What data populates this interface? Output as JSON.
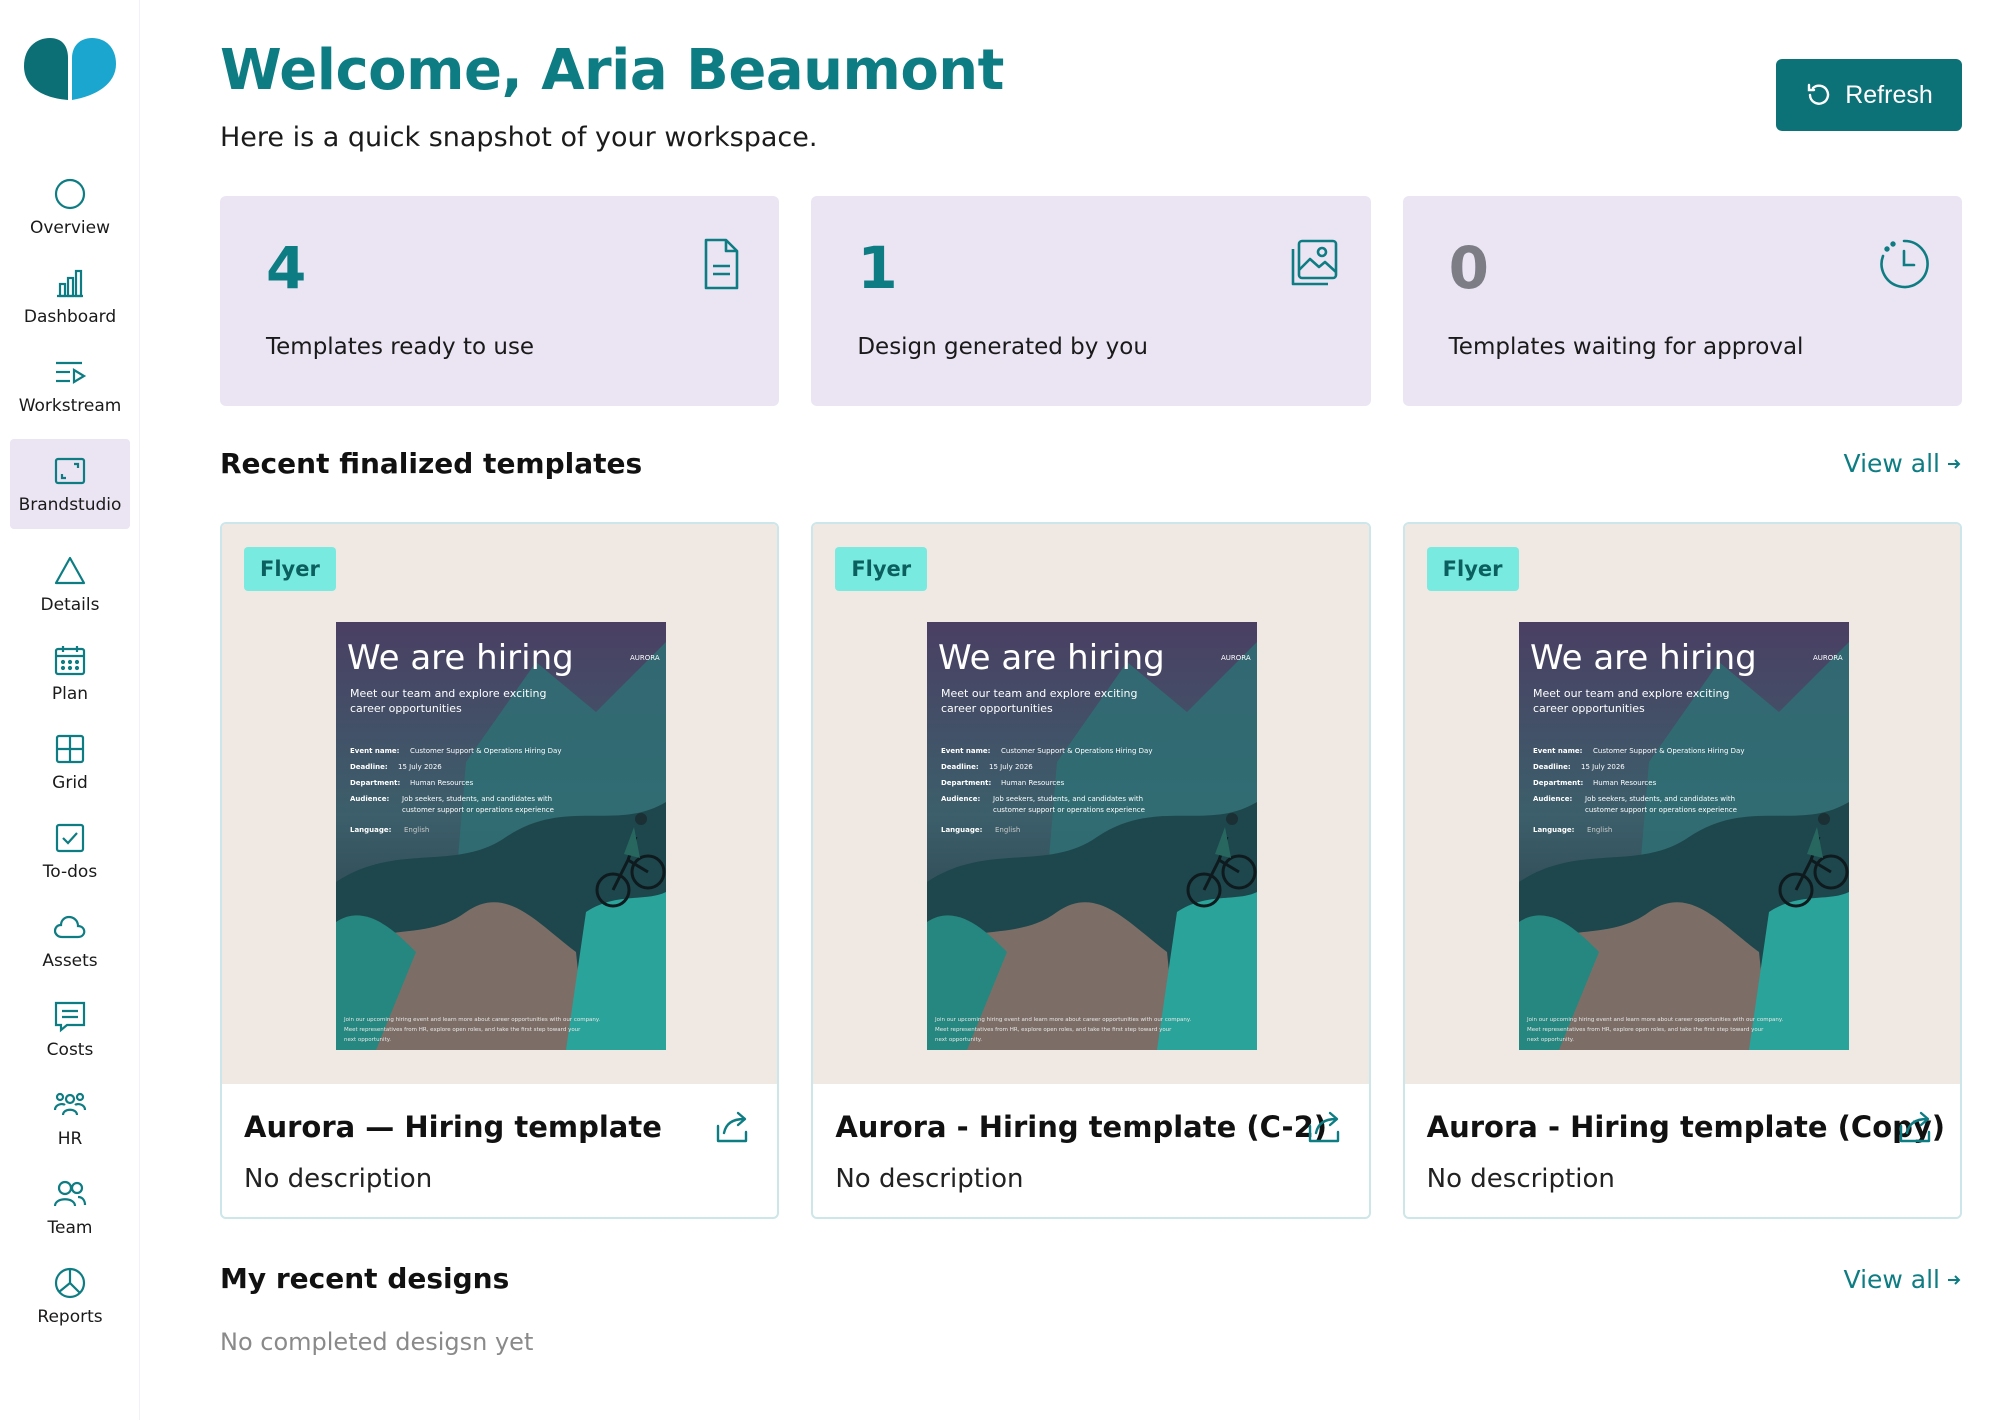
{
  "sidebar": {
    "items": [
      {
        "label": "Overview",
        "icon": "circle-icon"
      },
      {
        "label": "Dashboard",
        "icon": "bar-chart-icon"
      },
      {
        "label": "Workstream",
        "icon": "list-play-icon"
      },
      {
        "label": "Brandstudio",
        "icon": "frame-icon",
        "active": true
      },
      {
        "label": "Details",
        "icon": "triangle-icon"
      },
      {
        "label": "Plan",
        "icon": "calendar-icon"
      },
      {
        "label": "Grid",
        "icon": "grid-icon"
      },
      {
        "label": "To-dos",
        "icon": "checkbox-icon"
      },
      {
        "label": "Assets",
        "icon": "cloud-icon"
      },
      {
        "label": "Costs",
        "icon": "receipt-icon"
      },
      {
        "label": "HR",
        "icon": "people-icon"
      },
      {
        "label": "Team",
        "icon": "team-icon"
      },
      {
        "label": "Reports",
        "icon": "pie-chart-icon"
      }
    ]
  },
  "header": {
    "title": "Welcome, Aria Beaumont",
    "subtitle": "Here is a  quick snapshot of your workspace.",
    "refresh_label": "Refresh"
  },
  "stats": [
    {
      "value": "4",
      "label": "Templates ready to use",
      "icon": "document-icon"
    },
    {
      "value": "1",
      "label": "Design generated by you",
      "icon": "images-icon"
    },
    {
      "value": "0",
      "label": "Templates waiting for approval",
      "icon": "clock-icon"
    }
  ],
  "recent_templates": {
    "title": "Recent finalized templates",
    "view_all": "View all",
    "cards": [
      {
        "badge": "Flyer",
        "name": "Aurora — Hiring template",
        "description": "No description"
      },
      {
        "badge": "Flyer",
        "name": "Aurora - Hiring template (C-2)",
        "description": "No description"
      },
      {
        "badge": "Flyer",
        "name": "Aurora - Hiring template (Copy)",
        "description": "No description"
      }
    ]
  },
  "flyer": {
    "headline": "We are hiring",
    "tagline_1": "Meet our team and explore exciting",
    "tagline_2": "career opportunities",
    "event_label": "Event name:",
    "event_value": "Customer Support & Operations Hiring Day",
    "deadline_label": "Deadline:",
    "deadline_value": "15 July 2026",
    "department_label": "Department:",
    "department_value": "Human Resources",
    "audience_label": "Audience:",
    "audience_value_1": "Job seekers, students, and candidates with",
    "audience_value_2": "customer support or operations experience",
    "language_label": "Language:",
    "language_value": "English",
    "brand": "AURORA",
    "footer_1": "Join our upcoming hiring event and learn more about career opportunities with our company.",
    "footer_2": "Meet representatives from HR, explore open roles, and take the first step toward your",
    "footer_3": "next opportunity."
  },
  "recent_designs": {
    "title": "My recent designs",
    "view_all": "View all",
    "empty_text": "No completed desigsn yet"
  },
  "colors": {
    "accent": "#0e7d83",
    "button": "#0c7278",
    "stat_bg": "#ebe4f3",
    "badge_bg": "#79eadf",
    "card_border": "#cce6ea",
    "preview_bg": "#f0e8e2"
  }
}
